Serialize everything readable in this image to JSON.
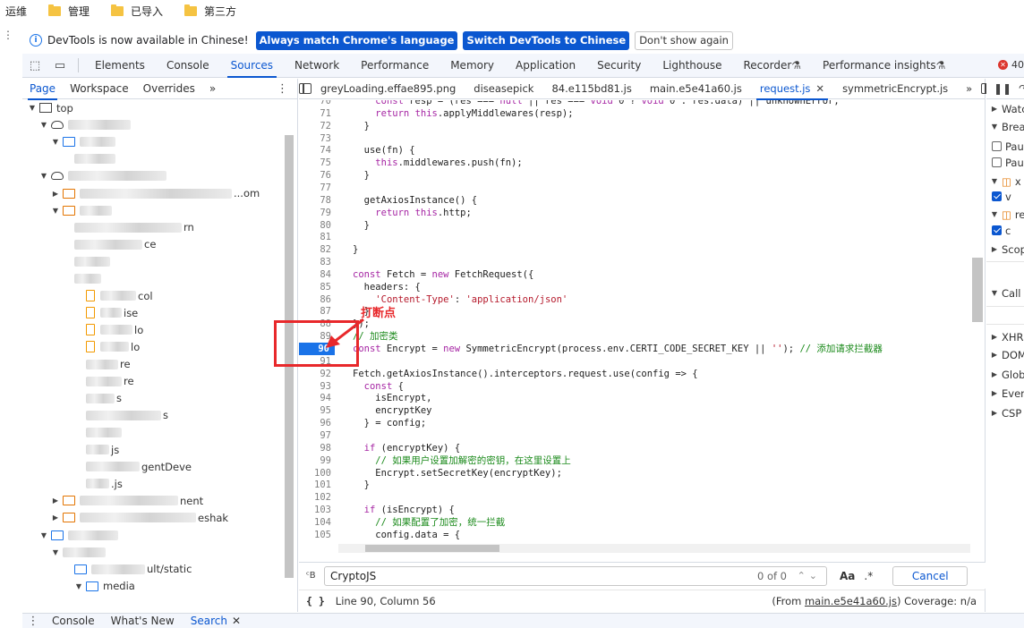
{
  "bookmarks": [
    {
      "label": "运维",
      "folder": false
    },
    {
      "label": "管理",
      "folder": true
    },
    {
      "label": "已导入",
      "folder": true
    },
    {
      "label": "第三方",
      "folder": true
    }
  ],
  "infobar": {
    "message": "DevTools is now available in Chinese!",
    "btn_match": "Always match Chrome's language",
    "btn_switch": "Switch DevTools to Chinese",
    "btn_dismiss": "Don't show again"
  },
  "main_tabs": [
    "Elements",
    "Console",
    "Sources",
    "Network",
    "Performance",
    "Memory",
    "Application",
    "Security",
    "Lighthouse",
    "Recorder",
    "Performance insights"
  ],
  "main_active": "Sources",
  "error_count": "40",
  "navigator": {
    "tabs": [
      "Page",
      "Workspace",
      "Overrides"
    ],
    "more": "»",
    "tree": [
      {
        "label": "top",
        "icon": "frame",
        "depth": 0,
        "tri": "▼"
      },
      {
        "label": "",
        "icon": "cloud",
        "depth": 1,
        "tri": "▼"
      },
      {
        "label": "",
        "icon": "folder-blue",
        "depth": 2,
        "tri": "▼"
      },
      {
        "label": "",
        "icon": "none",
        "depth": 3,
        "tri": ""
      },
      {
        "label": "",
        "icon": "cloud",
        "depth": 1,
        "tri": "▼"
      },
      {
        "label": "...om",
        "icon": "folder-orange",
        "depth": 2,
        "tri": "▶"
      },
      {
        "label": "",
        "icon": "folder-orange",
        "depth": 2,
        "tri": "▼"
      },
      {
        "label": "rn",
        "icon": "none",
        "depth": 3,
        "tri": ""
      },
      {
        "label": "ce",
        "icon": "none",
        "depth": 3,
        "tri": ""
      },
      {
        "label": "",
        "icon": "none",
        "depth": 3,
        "tri": ""
      },
      {
        "label": "",
        "icon": "none",
        "depth": 3,
        "tri": ""
      },
      {
        "label": "col",
        "icon": "file",
        "depth": 4,
        "tri": ""
      },
      {
        "label": "ise",
        "icon": "file",
        "depth": 4,
        "tri": ""
      },
      {
        "label": "lo",
        "icon": "file",
        "depth": 4,
        "tri": ""
      },
      {
        "label": "lo",
        "icon": "file",
        "depth": 4,
        "tri": ""
      },
      {
        "label": "re",
        "icon": "none",
        "depth": 4,
        "tri": ""
      },
      {
        "label": "re",
        "icon": "none",
        "depth": 4,
        "tri": ""
      },
      {
        "label": "s",
        "icon": "none",
        "depth": 4,
        "tri": ""
      },
      {
        "label": "s",
        "icon": "none",
        "depth": 4,
        "tri": ""
      },
      {
        "label": "",
        "icon": "none",
        "depth": 4,
        "tri": ""
      },
      {
        "label": "js",
        "icon": "none",
        "depth": 4,
        "tri": ""
      },
      {
        "label": "gentDeve",
        "icon": "none",
        "depth": 4,
        "tri": ""
      },
      {
        "label": ".js",
        "icon": "none",
        "depth": 4,
        "tri": ""
      },
      {
        "label": "nent",
        "icon": "folder-orange",
        "depth": 2,
        "tri": "▶"
      },
      {
        "label": "eshak",
        "icon": "folder-orange",
        "depth": 2,
        "tri": "▶"
      },
      {
        "label": "",
        "icon": "folder-blue",
        "depth": 1,
        "tri": "▼"
      },
      {
        "label": "",
        "icon": "none",
        "depth": 2,
        "tri": "▼"
      },
      {
        "label": "ult/static",
        "icon": "folder-blue",
        "depth": 3,
        "tri": ""
      },
      {
        "label": "media",
        "icon": "folder-blue",
        "depth": 4,
        "tri": "▼"
      }
    ]
  },
  "editor": {
    "tabs": [
      "greyLoading.effae895.png",
      "diseasepick",
      "84.e115bd81.js",
      "main.e5e41a60.js",
      "request.js",
      "symmetricEncrypt.js"
    ],
    "active_tab": "request.js",
    "more": "»",
    "breakpoint_line": 90,
    "lines": [
      {
        "n": "70",
        "code": "    const resp = (res === null || res === void 0 ? void 0 : res.data) || unknownError;"
      },
      {
        "n": "71",
        "code": "    return this.applyMiddlewares(resp);"
      },
      {
        "n": "72",
        "code": "  }"
      },
      {
        "n": "73",
        "code": ""
      },
      {
        "n": "74",
        "code": "  use(fn) {"
      },
      {
        "n": "75",
        "code": "    this.middlewares.push(fn);"
      },
      {
        "n": "76",
        "code": "  }"
      },
      {
        "n": "77",
        "code": ""
      },
      {
        "n": "78",
        "code": "  getAxiosInstance() {"
      },
      {
        "n": "79",
        "code": "    return this.http;"
      },
      {
        "n": "80",
        "code": "  }"
      },
      {
        "n": "81",
        "code": ""
      },
      {
        "n": "82",
        "code": "}"
      },
      {
        "n": "83",
        "code": ""
      },
      {
        "n": "84",
        "code": "const Fetch = new FetchRequest({"
      },
      {
        "n": "85",
        "code": "  headers: {"
      },
      {
        "n": "86",
        "code": "    'Content-Type': 'application/json'"
      },
      {
        "n": "87",
        "code": "  }"
      },
      {
        "n": "88",
        "code": "});"
      },
      {
        "n": "89",
        "code": "// 加密类"
      },
      {
        "n": "90",
        "code": "const Encrypt = new SymmetricEncrypt(process.env.CERTI_CODE_SECRET_KEY || ''); // 添加请求拦截器"
      },
      {
        "n": "91",
        "code": ""
      },
      {
        "n": "92",
        "code": "Fetch.getAxiosInstance().interceptors.request.use(config => {"
      },
      {
        "n": "93",
        "code": "  const {"
      },
      {
        "n": "94",
        "code": "    isEncrypt,"
      },
      {
        "n": "95",
        "code": "    encryptKey"
      },
      {
        "n": "96",
        "code": "  } = config;"
      },
      {
        "n": "97",
        "code": ""
      },
      {
        "n": "98",
        "code": "  if (encryptKey) {"
      },
      {
        "n": "99",
        "code": "    // 如果用户设置加解密的密钥，在这里设置上"
      },
      {
        "n": "100",
        "code": "    Encrypt.setSecretKey(encryptKey);"
      },
      {
        "n": "101",
        "code": "  }"
      },
      {
        "n": "102",
        "code": ""
      },
      {
        "n": "103",
        "code": "  if (isEncrypt) {"
      },
      {
        "n": "104",
        "code": "    // 如果配置了加密，统一拦截"
      },
      {
        "n": "105",
        "code": "    config.data = {"
      }
    ]
  },
  "search": {
    "value": "CryptoJS",
    "count": "0 of 0",
    "match_case": "Aa",
    "regex": ".*",
    "cancel": "Cancel"
  },
  "status": {
    "position": "Line 90, Column 56",
    "from_prefix": "(From ",
    "from_file": "main.e5e41a60.js",
    "from_suffix": ")",
    "coverage": "Coverage: n/a"
  },
  "debugger": [
    {
      "label": "Watc",
      "type": "section",
      "tri": "▶"
    },
    {
      "label": "Brea",
      "type": "section",
      "tri": "▼"
    },
    {
      "label": "Pau",
      "type": "check",
      "checked": false
    },
    {
      "label": "Pau",
      "type": "check",
      "checked": false
    },
    {
      "label": "x",
      "type": "file",
      "tri": "▼"
    },
    {
      "label": "v",
      "type": "check",
      "checked": true
    },
    {
      "label": "re",
      "type": "file",
      "tri": "▼"
    },
    {
      "label": "c",
      "type": "check",
      "checked": true
    },
    {
      "label": "Scop",
      "type": "section",
      "tri": "▶"
    },
    {
      "label": "Call",
      "type": "section",
      "tri": "▼"
    },
    {
      "label": "XHR",
      "type": "section",
      "tri": "▶"
    },
    {
      "label": "DOM",
      "type": "section",
      "tri": "▶"
    },
    {
      "label": "Glob",
      "type": "section",
      "tri": "▶"
    },
    {
      "label": "Even",
      "type": "section",
      "tri": "▶"
    },
    {
      "label": "CSP",
      "type": "section",
      "tri": "▶"
    }
  ],
  "drawer_tabs": [
    "Console",
    "What's New",
    "Search"
  ],
  "drawer_active": "Search",
  "annotation": {
    "label": "打断点"
  },
  "colors": {
    "accent": "#0b57d0",
    "annotation": "#e8282b",
    "breakpoint": "#1a73e8"
  }
}
